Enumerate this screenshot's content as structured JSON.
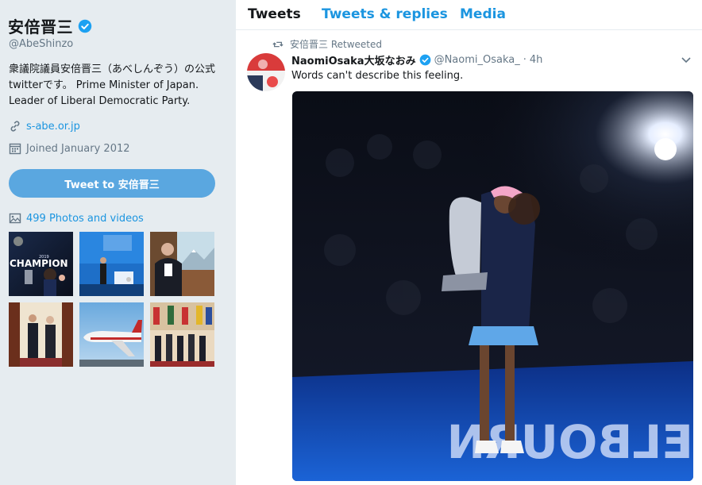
{
  "profile": {
    "name": "安倍晋三",
    "handle": "@AbeShinzo",
    "bio": "衆議院議員安倍晋三（あべしんぞう）の公式twitterです。 Prime Minister of Japan. Leader of Liberal Democratic Party.",
    "website": "s-abe.or.jp",
    "joined": "Joined January 2012",
    "tweet_to_label": "Tweet to 安倍晋三",
    "photos_label": "499 Photos and videos"
  },
  "photo_grid": {
    "thumb1_text": "CHAMPION",
    "thumb1_small": "2019"
  },
  "tabs": {
    "tweets": "Tweets",
    "replies": "Tweets & replies",
    "media": "Media"
  },
  "tweet": {
    "retweet_label": "安倍晋三 Retweeted",
    "author_name": "NaomiOsaka大坂なおみ",
    "author_handle": "@Naomi_Osaka_",
    "dot": "·",
    "time": "4h",
    "text": "Words can't describe this feeling.",
    "court_text": "ELBOURN"
  },
  "colors": {
    "accent": "#1b95e0",
    "button": "#5aa7e0",
    "sidebar_bg": "#e6ecf0",
    "verified": "#1da1f2"
  },
  "icons": {
    "verified": "verified-badge-icon",
    "link": "link-icon",
    "calendar": "calendar-icon",
    "photos": "image-icon",
    "retweet": "retweet-icon",
    "caret": "chevron-down-icon"
  }
}
